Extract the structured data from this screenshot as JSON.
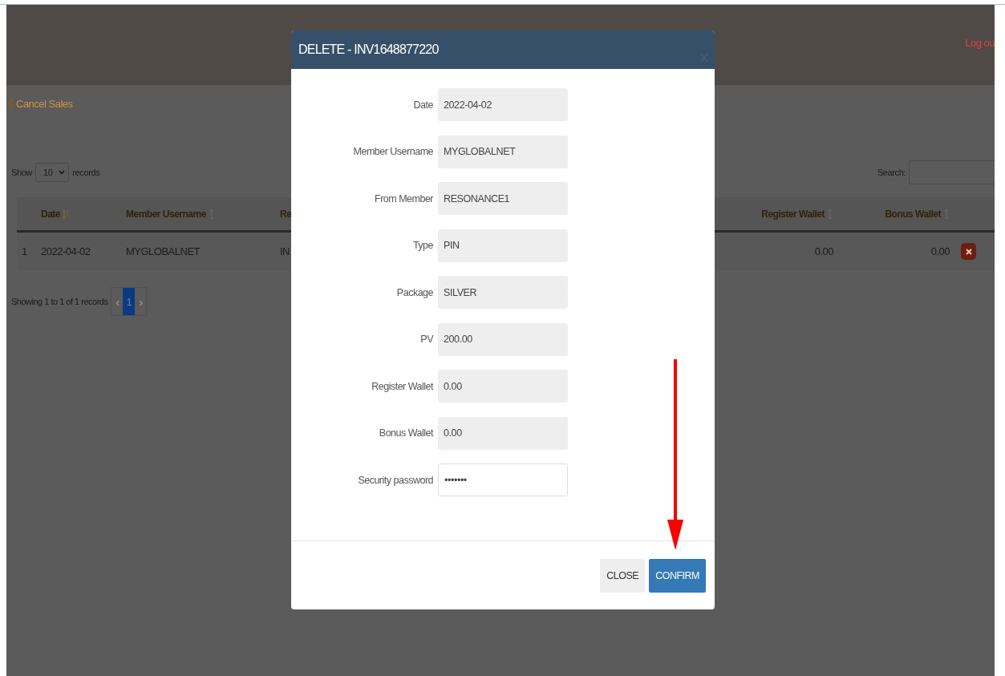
{
  "header": {
    "logout_link": "Log ou"
  },
  "page": {
    "back_link": "Cancel Sales"
  },
  "table_controls": {
    "show_label": "Show",
    "page_size": "10",
    "records_label": "records",
    "search_label": "Search:"
  },
  "table": {
    "columns": [
      {
        "label": "Date",
        "sortable": true,
        "sorted": true
      },
      {
        "label": "Member Username",
        "sortable": true,
        "sorted": false
      },
      {
        "label": "Re"
      },
      {
        "label": "Register Wallet",
        "sortable": true,
        "sorted": false
      },
      {
        "label": "Bonus Wallet",
        "sortable": true,
        "sorted": false
      }
    ],
    "rows": [
      {
        "index": "1",
        "cells": [
          "2022-04-02",
          "MYGLOBALNET",
          "IN",
          "0.00",
          "0.00"
        ]
      }
    ]
  },
  "pagination": {
    "info": "Showing 1 to 1 of 1 records",
    "previous": "‹",
    "next": "›",
    "pages": [
      {
        "label": "1",
        "selected": true
      }
    ]
  },
  "modal": {
    "title": "DELETE - INV1648877220",
    "fields": [
      {
        "label": "Date",
        "value": "2022-04-02",
        "kind": "readonly"
      },
      {
        "label": "Member Username",
        "value": "MYGLOBALNET",
        "kind": "readonly"
      },
      {
        "label": "From Member",
        "value": "RESONANCE1",
        "kind": "readonly"
      },
      {
        "label": "Type",
        "value": "PIN",
        "kind": "readonly"
      },
      {
        "label": "Package",
        "value": "SILVER",
        "kind": "readonly"
      },
      {
        "label": "PV",
        "value": "200.00",
        "kind": "readonly"
      },
      {
        "label": "Register Wallet",
        "value": "0.00",
        "kind": "readonly"
      },
      {
        "label": "Bonus Wallet",
        "value": "0.00",
        "kind": "readonly"
      },
      {
        "label": "Security password",
        "value": "•••••••",
        "kind": "password"
      }
    ],
    "buttons": [
      {
        "label": "CLOSE",
        "kind": "default"
      },
      {
        "label": "CONFIRM",
        "kind": "primary"
      }
    ]
  }
}
